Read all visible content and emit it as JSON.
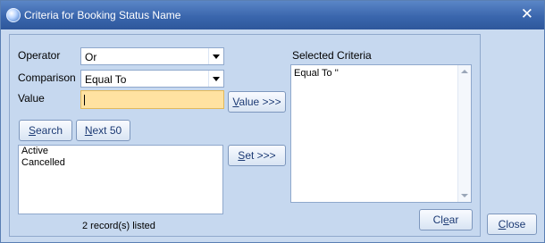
{
  "window": {
    "title": "Criteria for Booking Status Name",
    "close_glyph": "✕",
    "icon": "app-globe-icon"
  },
  "form": {
    "operator": {
      "label": "Operator",
      "value": "Or"
    },
    "comparison": {
      "label": "Comparison",
      "value": "Equal To"
    },
    "value": {
      "label": "Value",
      "current_value": ""
    }
  },
  "buttons": {
    "value": {
      "hotkey": "V",
      "rest": "alue >>>"
    },
    "search": {
      "hotkey": "S",
      "rest": "earch"
    },
    "next50": {
      "hotkey": "N",
      "rest": "ext 50"
    },
    "set": {
      "hotkey": "S",
      "rest": "et >>>"
    },
    "clear": {
      "pre": "Cl",
      "hotkey": "e",
      "rest": "ar"
    },
    "close": {
      "hotkey": "C",
      "rest": "lose"
    }
  },
  "results": {
    "items": [
      "Active",
      "Cancelled"
    ],
    "status": "2 record(s) listed"
  },
  "criteria": {
    "label": "Selected Criteria",
    "text": "Equal To ''"
  },
  "colors": {
    "title_bar": "#3a66ad",
    "panel": "#c6d8ef",
    "value_field": "#ffe2a1"
  }
}
